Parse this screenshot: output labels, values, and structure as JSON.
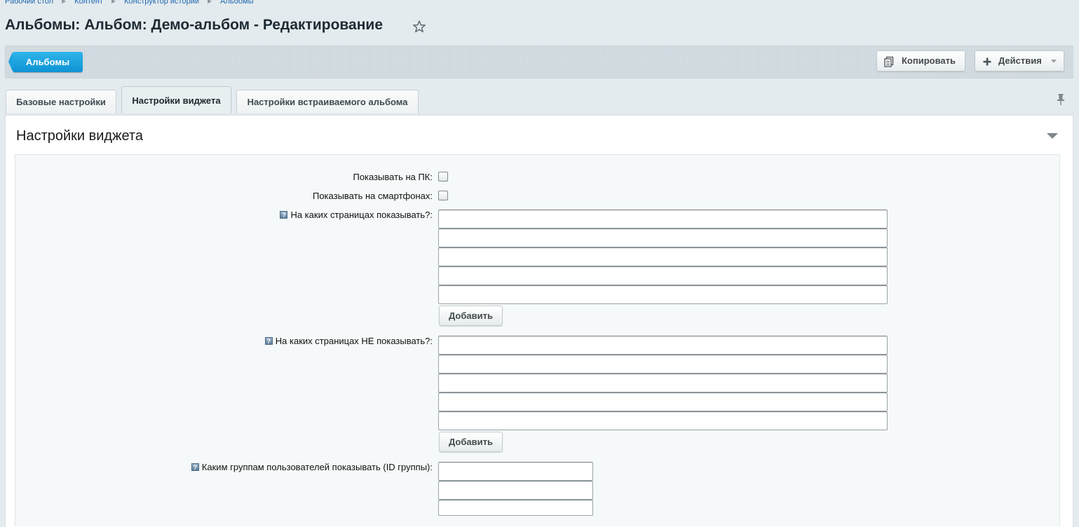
{
  "breadcrumb": {
    "items": [
      "Рабочий стол",
      "Контент",
      "Конструктор истории",
      "Альбомы"
    ]
  },
  "page": {
    "title": "Альбомы: Альбом: Демо-альбом - Редактирование"
  },
  "toolbar": {
    "back_label": "Альбомы",
    "copy_label": "Копировать",
    "actions_label": "Действия"
  },
  "tabs": [
    {
      "label": "Базовые настройки",
      "active": false
    },
    {
      "label": "Настройки виджета",
      "active": true
    },
    {
      "label": "Настройки встраиваемого альбома",
      "active": false
    }
  ],
  "section": {
    "title": "Настройки виджета"
  },
  "form": {
    "show_pc_label": "Показывать на ПК:",
    "show_pc_checked": false,
    "show_mobile_label": "Показывать на смартфонах:",
    "show_mobile_checked": false,
    "pages_show_label": "На каких страницах показывать?:",
    "pages_show_values": [
      "",
      "",
      "",
      "",
      ""
    ],
    "pages_hide_label": "На каких страницах НЕ показывать?:",
    "pages_hide_values": [
      "",
      "",
      "",
      "",
      ""
    ],
    "groups_label": "Каким группам пользователей показывать (ID группы):",
    "groups_values": [
      "",
      "",
      ""
    ],
    "add_label": "Добавить",
    "help_glyph": "?"
  },
  "icons": {
    "star": "star-icon",
    "copy": "copy-icon",
    "plus": "plus-icon",
    "caret": "caret-down-icon",
    "pin": "pin-icon",
    "collapse": "collapse-arrow-icon",
    "help": "help-icon"
  },
  "colors": {
    "accent": "#0e93d4",
    "background": "#e4ebee",
    "form_bg": "#f5f9f9"
  }
}
